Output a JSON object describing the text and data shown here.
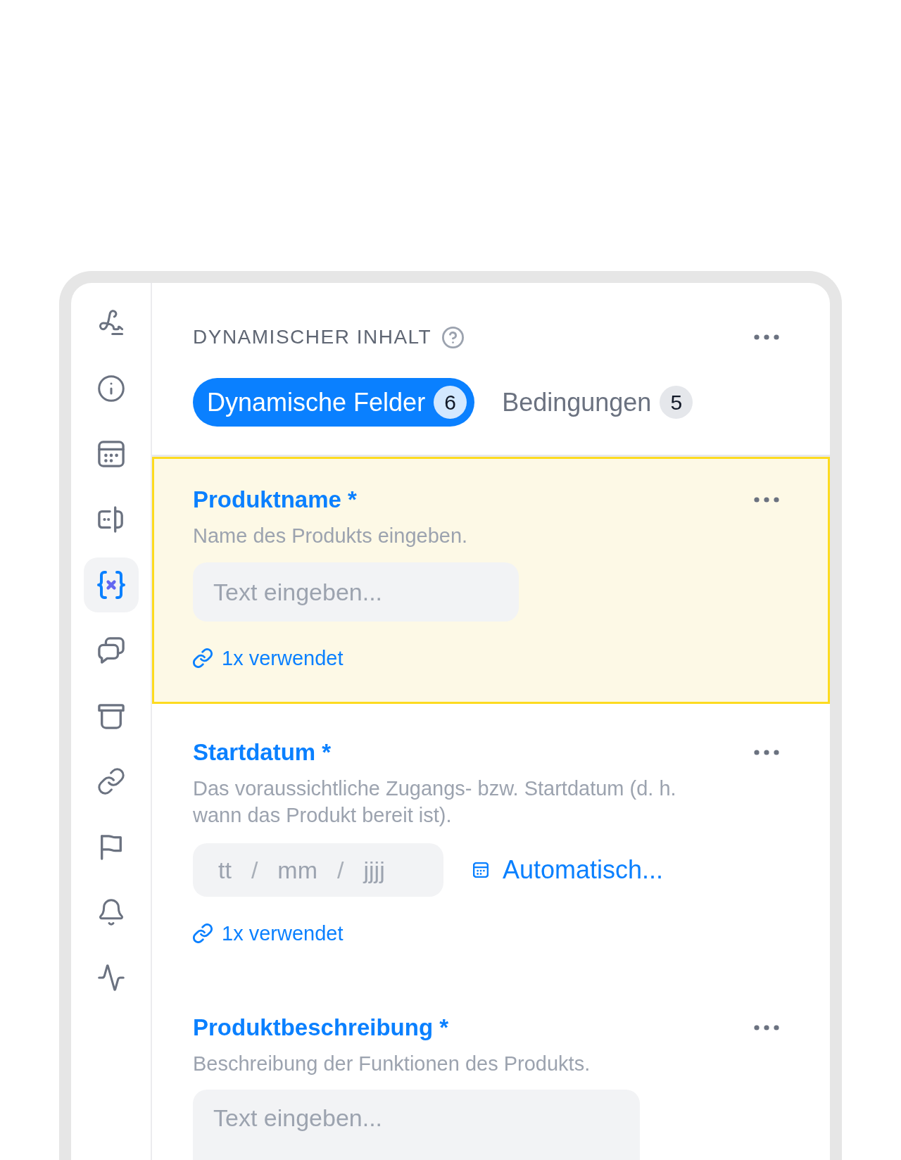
{
  "sidebar": {
    "items": [
      {
        "selected": false
      },
      {
        "selected": false
      },
      {
        "selected": false
      },
      {
        "selected": false
      },
      {
        "selected": true
      },
      {
        "selected": false
      },
      {
        "selected": false
      },
      {
        "selected": false
      },
      {
        "selected": false
      },
      {
        "selected": false
      },
      {
        "selected": false
      }
    ]
  },
  "panel": {
    "title": "DYNAMISCHER INHALT",
    "tabs": [
      {
        "label": "Dynamische Felder",
        "count": "6",
        "selected": true
      },
      {
        "label": "Bedingungen",
        "count": "5",
        "selected": false
      }
    ],
    "fields": [
      {
        "kind": "text",
        "title": "Produktname *",
        "description": "Name des Produkts eingeben.",
        "placeholder": "Text eingeben...",
        "usage": "1x verwendet",
        "selected": true
      },
      {
        "kind": "date",
        "title": "Startdatum *",
        "description": "Das voraussichtliche Zugangs- bzw. Startdatum (d. h. wann das Produkt bereit ist).",
        "parts": [
          {
            "kind": "segment",
            "placeholder": "tt"
          },
          {
            "kind": "separator",
            "text": "/"
          },
          {
            "kind": "segment",
            "placeholder": "mm"
          },
          {
            "kind": "separator",
            "text": "/"
          },
          {
            "kind": "segment",
            "placeholder": "jjjj"
          }
        ],
        "auto_button": "Automatisch...",
        "usage": "1x verwendet",
        "selected": false
      },
      {
        "kind": "textarea",
        "title": "Produktbeschreibung *",
        "description": "Beschreibung der Funktionen des Produkts.",
        "placeholder": "Text eingeben...",
        "selected": false
      }
    ]
  }
}
